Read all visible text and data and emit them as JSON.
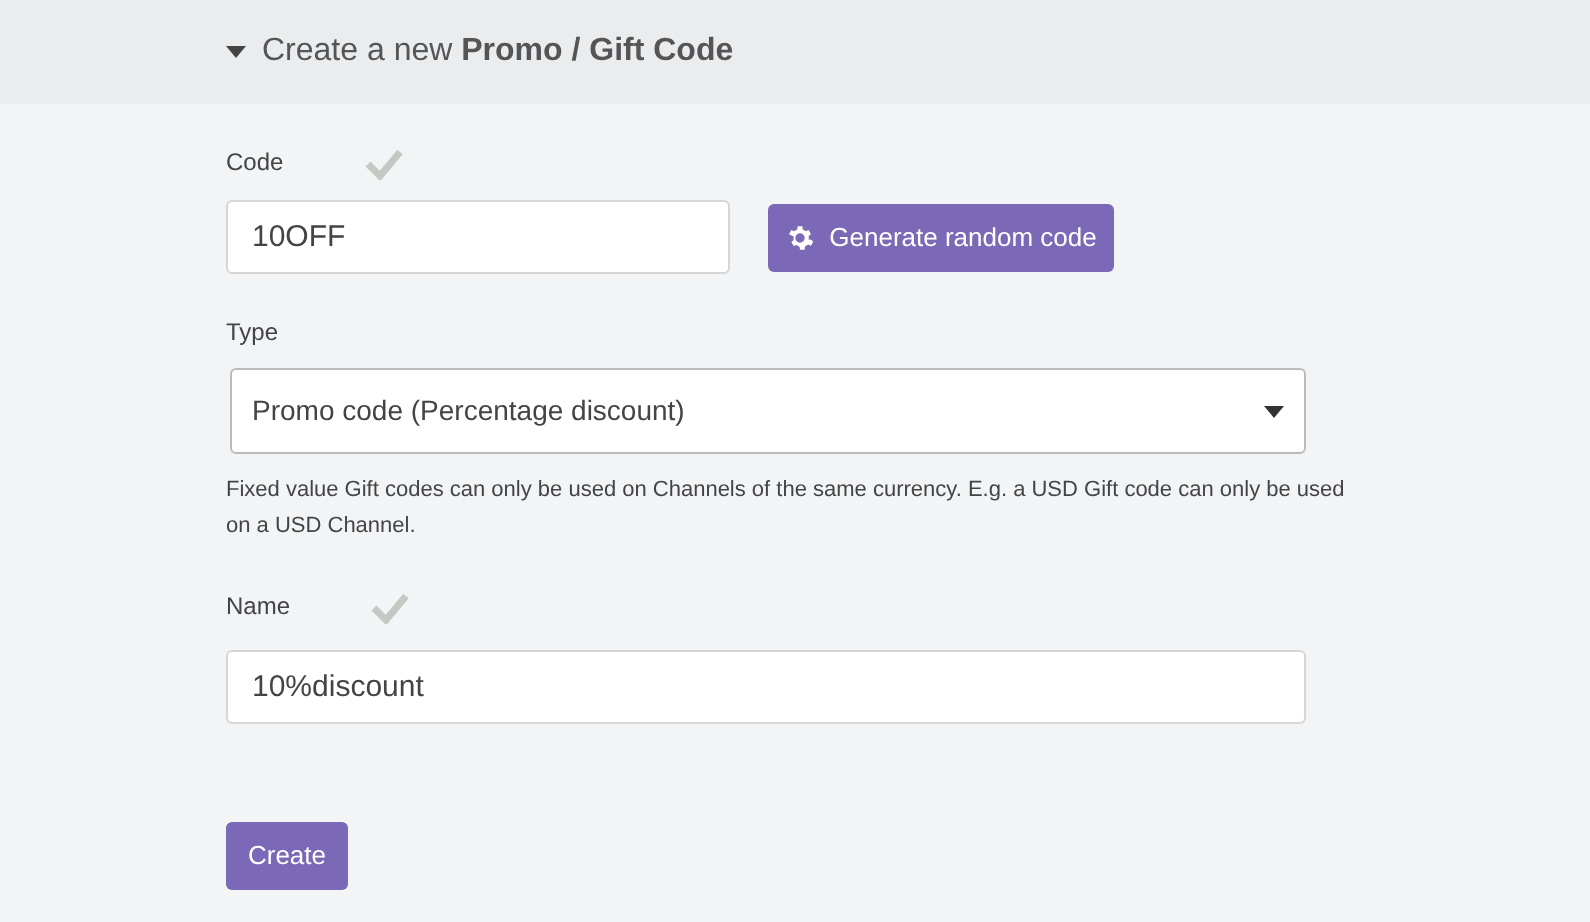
{
  "section": {
    "expanded": true,
    "title": "Create a new **Promo / Gift Code**"
  },
  "code_field": {
    "label": "Code",
    "valid": true,
    "value": "10OFF"
  },
  "generate_button": {
    "label": "Generate random code"
  },
  "type_field": {
    "label": "Type",
    "value": "Promo code (Percentage discount)",
    "help": "Fixed value Gift codes can only be used on Channels of the same currency. E.g. a USD Gift code can only be used on a USD Channel."
  },
  "name_field": {
    "label": "Name",
    "valid": true,
    "value": "10%discount"
  },
  "create_button": {
    "label": "Create"
  }
}
